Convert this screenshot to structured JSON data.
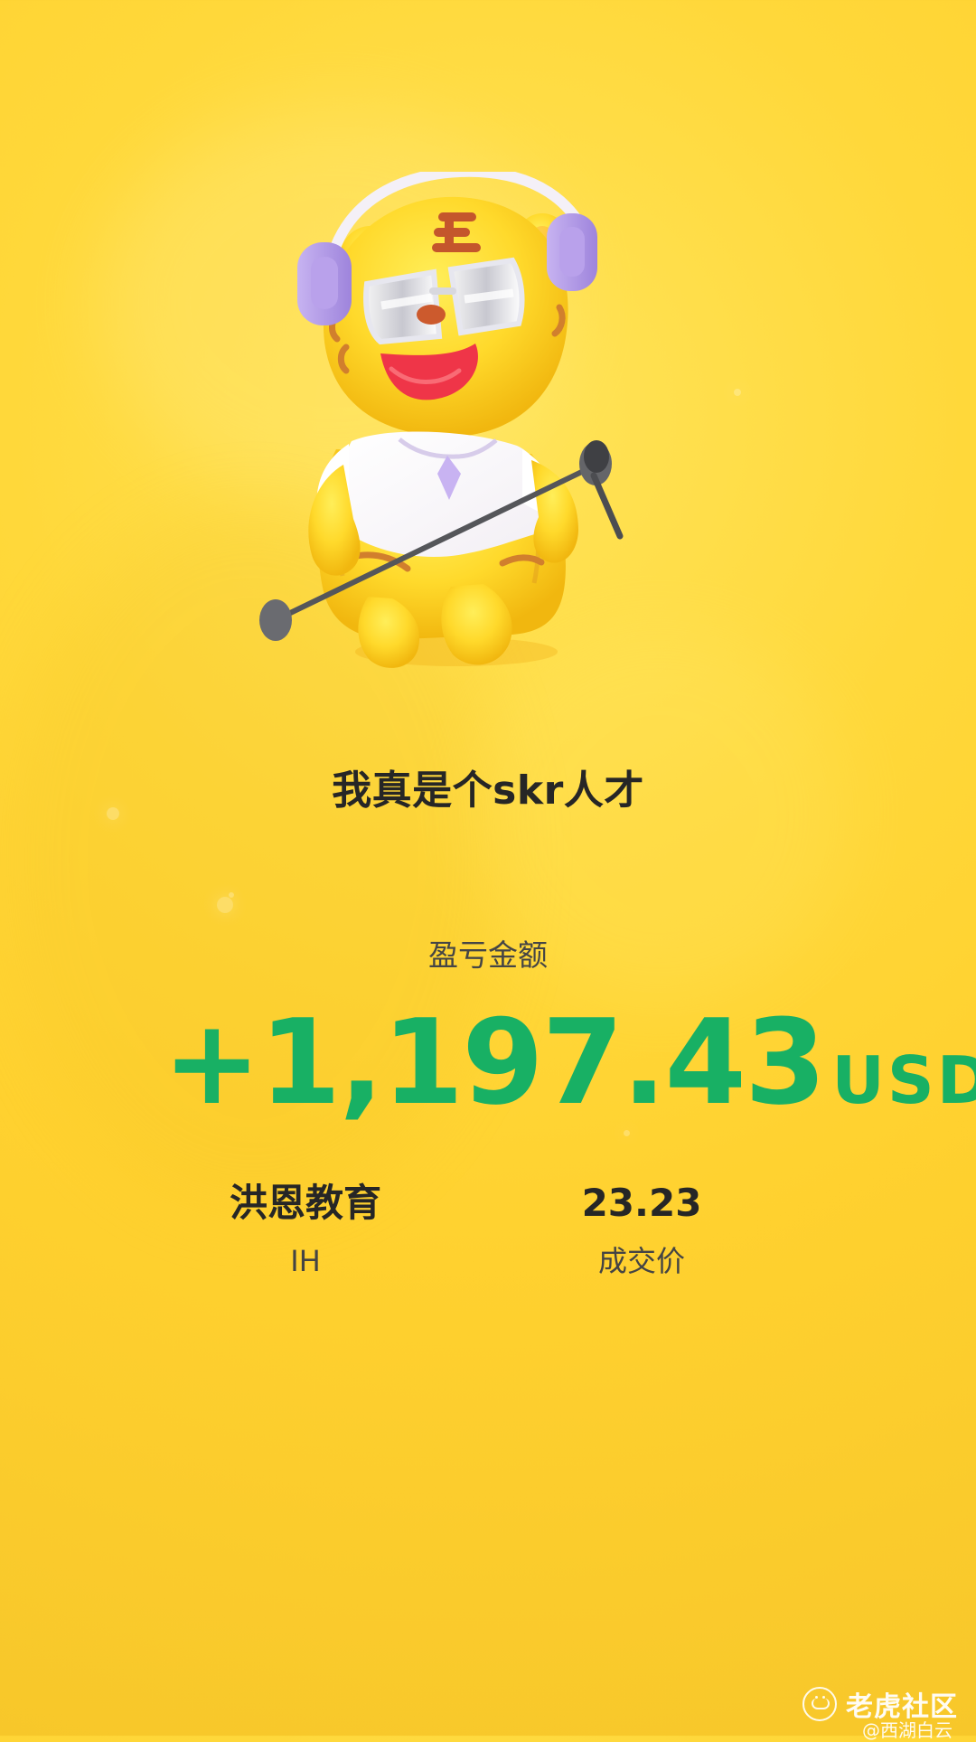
{
  "title": "我真是个skr人才",
  "label": "盈亏金额",
  "amount": "+1,197.43",
  "currency": "USD",
  "stock_name": "洪恩教育",
  "stock_symbol": "IH",
  "price_value": "23.23",
  "price_label": "成交价",
  "watermark": "老虎社区",
  "watermark_sub": "@西湖白云",
  "colors": {
    "background": "#ffd83a",
    "accent_green": "#18b064",
    "text_dark": "#262626"
  },
  "icons": {
    "watermark": "tiger-logo-icon",
    "hero": "tiger-mascot-icon"
  }
}
